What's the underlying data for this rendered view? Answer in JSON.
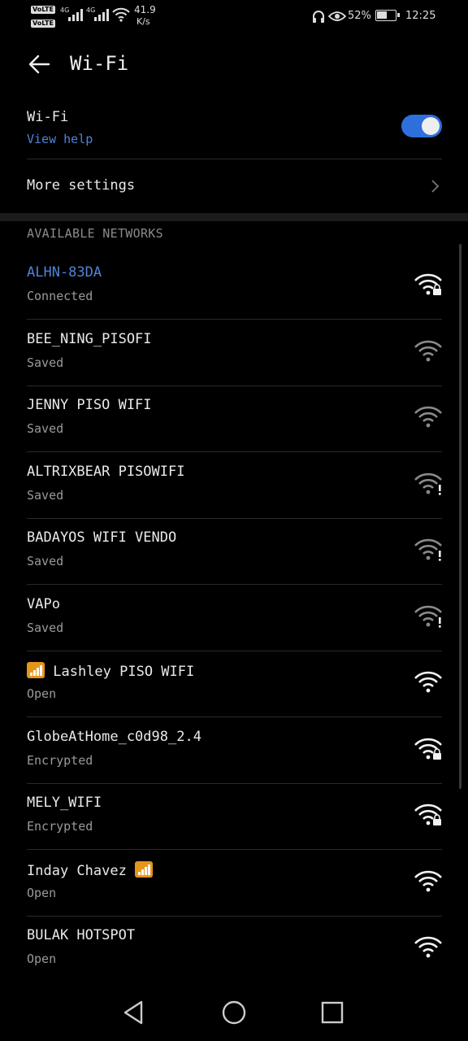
{
  "status_bar": {
    "volte_1": "VoLTE",
    "volte_2": "VoLTE",
    "net_type_1": "4G",
    "net_type_2": "4G",
    "speed_value": "41.9",
    "speed_unit": "K/s",
    "battery_percent": "52%",
    "time": "12:25"
  },
  "header": {
    "title": "Wi-Fi"
  },
  "wifi_toggle": {
    "label": "Wi-Fi",
    "help_link": "View help",
    "enabled": true
  },
  "more_settings": {
    "label": "More settings"
  },
  "section": {
    "title": "AVAILABLE NETWORKS"
  },
  "networks": [
    {
      "name": "ALHN-83DA",
      "status": "Connected",
      "icon": "wifi-lock-icon"
    },
    {
      "name": "BEE_NING_PISOFI",
      "status": "Saved",
      "icon": "wifi-weak-icon"
    },
    {
      "name": "JENNY PISO WIFI",
      "status": "Saved",
      "icon": "wifi-weak-icon"
    },
    {
      "name": "ALTRIXBEAR PISOWIFI",
      "status": "Saved",
      "icon": "wifi-alert-icon"
    },
    {
      "name": "BADAYOS WIFI VENDO",
      "status": "Saved",
      "icon": "wifi-alert-icon"
    },
    {
      "name": "VAPo",
      "status": "Saved",
      "icon": "wifi-alert-icon"
    },
    {
      "name": "Lashley PISO WIFI",
      "status": "Open",
      "icon": "wifi-icon"
    },
    {
      "name": "GlobeAtHome_c0d98_2.4",
      "status": "Encrypted",
      "icon": "wifi-lock-icon"
    },
    {
      "name": "MELY_WIFI",
      "status": "Encrypted",
      "icon": "wifi-lock-icon"
    },
    {
      "name": "Inday Chavez",
      "status": "Open",
      "icon": "wifi-icon"
    },
    {
      "name": "BULAK HOTSPOT",
      "status": "Open",
      "icon": "wifi-icon"
    }
  ],
  "colors": {
    "accent": "#2f6fdc",
    "link": "#4f83d8",
    "background": "#000000",
    "emoji_orange": "#e6951b"
  }
}
